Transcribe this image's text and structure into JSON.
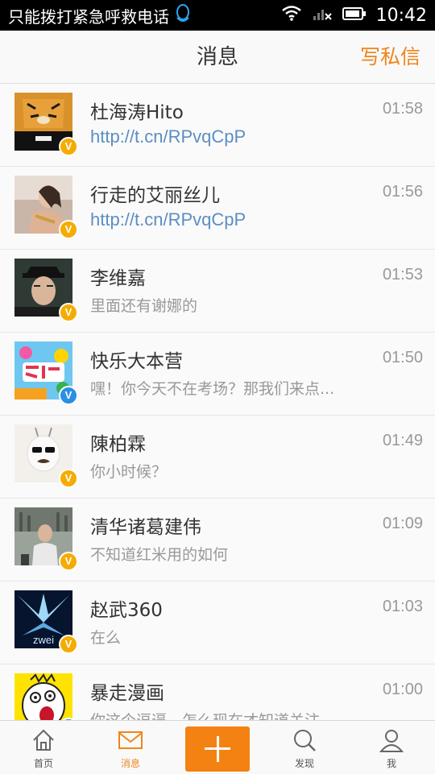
{
  "status_bar": {
    "carrier_text": "只能拨打紧急呼救电话",
    "time": "10:42",
    "icons": [
      "qq-icon",
      "wifi-icon",
      "signal-icon",
      "battery-icon"
    ]
  },
  "header": {
    "title": "消息",
    "compose_label": "写私信"
  },
  "messages": [
    {
      "name": "杜海涛Hito",
      "time": "01:58",
      "preview": "http://t.cn/RPvqCpP",
      "badge": "V"
    },
    {
      "name": "行走的艾丽丝儿",
      "time": "01:56",
      "preview": "http://t.cn/RPvqCpP",
      "badge": "V"
    },
    {
      "name": "李维嘉",
      "time": "01:53",
      "preview": "里面还有谢娜的",
      "badge": "V"
    },
    {
      "name": "快乐大本营",
      "time": "01:50",
      "preview": "嘿！你今天不在考场？那我们来点...",
      "badge": "V"
    },
    {
      "name": "陳柏霖",
      "time": "01:49",
      "preview": "你小时候？",
      "badge": "V"
    },
    {
      "name": "清华诸葛建伟",
      "time": "01:09",
      "preview": "不知道红米用的如何",
      "badge": "V"
    },
    {
      "name": "赵武360",
      "time": "01:03",
      "preview": "在么",
      "badge": "V"
    },
    {
      "name": "暴走漫画",
      "time": "01:00",
      "preview": "你这个逗逼，怎么现在才知道关注",
      "badge": "V"
    }
  ],
  "tabbar": {
    "home": "首页",
    "messages": "消息",
    "discover": "发现",
    "me": "我"
  },
  "colors": {
    "accent": "#f08519",
    "link": "#5b8ec3",
    "badge_orange": "#f6ab00",
    "badge_blue": "#2a8fe5"
  }
}
